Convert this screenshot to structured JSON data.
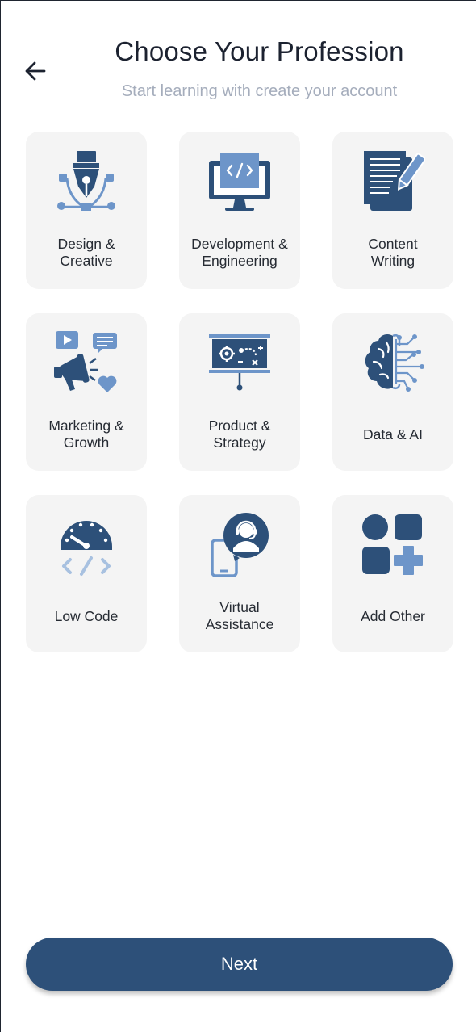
{
  "header": {
    "title": "Choose Your Profession",
    "subtitle": "Start learning with create your account",
    "back_icon": "arrow-left-icon"
  },
  "professions": [
    {
      "label": "Design &\nCreative",
      "icon": "pen-tool-icon"
    },
    {
      "label": "Development &\nEngineering",
      "icon": "code-monitor-icon"
    },
    {
      "label": "Content\nWriting",
      "icon": "document-pencil-icon"
    },
    {
      "label": "Marketing &\nGrowth",
      "icon": "megaphone-icon"
    },
    {
      "label": "Product &\nStrategy",
      "icon": "presentation-board-icon"
    },
    {
      "label": "Data & AI",
      "icon": "brain-circuit-icon"
    },
    {
      "label": "Low Code",
      "icon": "speedometer-code-icon"
    },
    {
      "label": "Virtual\nAssistance",
      "icon": "headset-support-icon"
    },
    {
      "label": "Add Other",
      "icon": "add-app-icon"
    }
  ],
  "footer": {
    "next_label": "Next"
  },
  "colors": {
    "primary": "#2d5079",
    "accent": "#6d95c9",
    "card_bg": "#f4f4f4",
    "subtitle": "#a5adbc"
  }
}
